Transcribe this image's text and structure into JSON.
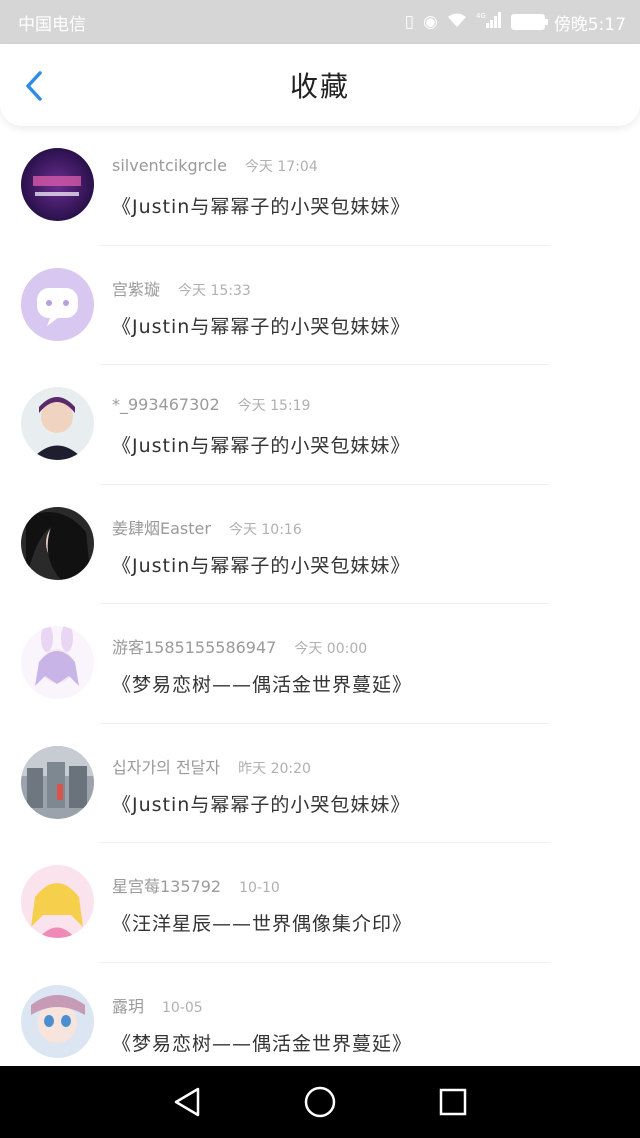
{
  "status_bar": {
    "carrier": "中国电信",
    "time": "傍晚5:17",
    "network_label": "4G"
  },
  "header": {
    "title": "收藏"
  },
  "items": [
    {
      "name": "silventcikgrcle",
      "time": "今天 17:04",
      "book": "《Justin与幂幂子的小哭包妹妹》",
      "avatar": "purple-space"
    },
    {
      "name": "宫紫璇",
      "time": "今天 15:33",
      "book": "《Justin与幂幂子的小哭包妹妹》",
      "avatar": "lavender-chat"
    },
    {
      "name": "*_993467302",
      "time": "今天 15:19",
      "book": "《Justin与幂幂子的小哭包妹妹》",
      "avatar": "boy-portrait"
    },
    {
      "name": "姜肆烟Easter",
      "time": "今天 10:16",
      "book": "《Justin与幂幂子的小哭包妹妹》",
      "avatar": "girl-dark-hair"
    },
    {
      "name": "游客1585155586947",
      "time": "今天 00:00",
      "book": "《梦易恋树——偶活金世界蔓延》",
      "avatar": "anime-bunny"
    },
    {
      "name": "십자가의 전달자",
      "time": "昨天 20:20",
      "book": "《Justin与幂幂子的小哭包妹妹》",
      "avatar": "city-photo"
    },
    {
      "name": "星宫莓135792",
      "time": "10-10",
      "book": "《汪洋星辰——世界偶像集介印》",
      "avatar": "anime-blonde"
    },
    {
      "name": "露玥",
      "time": "10-05",
      "book": "《梦易恋树——偶活金世界蔓延》",
      "avatar": "anime-blue-eyes"
    }
  ],
  "colors": {
    "accent": "#2e8be6",
    "status_bar_bg": "#d6d6d6",
    "nav_bar_bg": "#000000"
  }
}
